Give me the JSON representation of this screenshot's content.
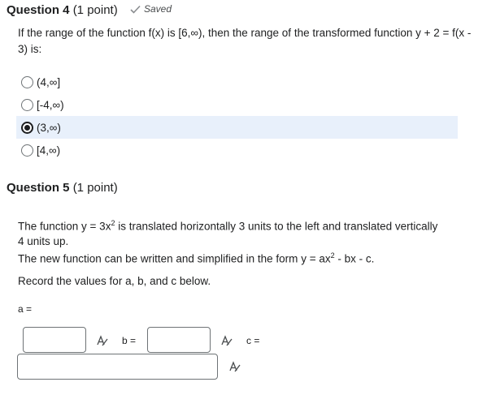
{
  "q4": {
    "title": "Question 4",
    "points": "(1 point)",
    "saved": "Saved",
    "text": "If the range of the function f(x) is [6,∞), then the range of the transformed function y + 2 = f(x - 3) is:",
    "options": [
      "(4,∞]",
      "[-4,∞)",
      "(3,∞)",
      "[4,∞)"
    ],
    "selected_index": 2
  },
  "q5": {
    "title": "Question 5",
    "points": "(1 point)",
    "line1_a": "The function ",
    "line1_eq": "y = 3x",
    "line1_sup": "2",
    "line1_b": " is translated horizontally 3 units to the left and translated vertically 4 units up.",
    "line2_a": "The new function can be written and simplified in the form ",
    "line2_eq": "y = ax",
    "line2_sup": "2",
    "line2_b": " - bx - c.",
    "line3": "Record the values for a, b, and c below.",
    "label_a": "a =",
    "label_b": "b =",
    "label_c": "c ="
  },
  "icons": {
    "check": "check-icon",
    "math": "equation-editor-icon"
  },
  "colors": {
    "selected_bg": "#e8f0fb",
    "text": "#202122",
    "border": "#6e7376"
  }
}
